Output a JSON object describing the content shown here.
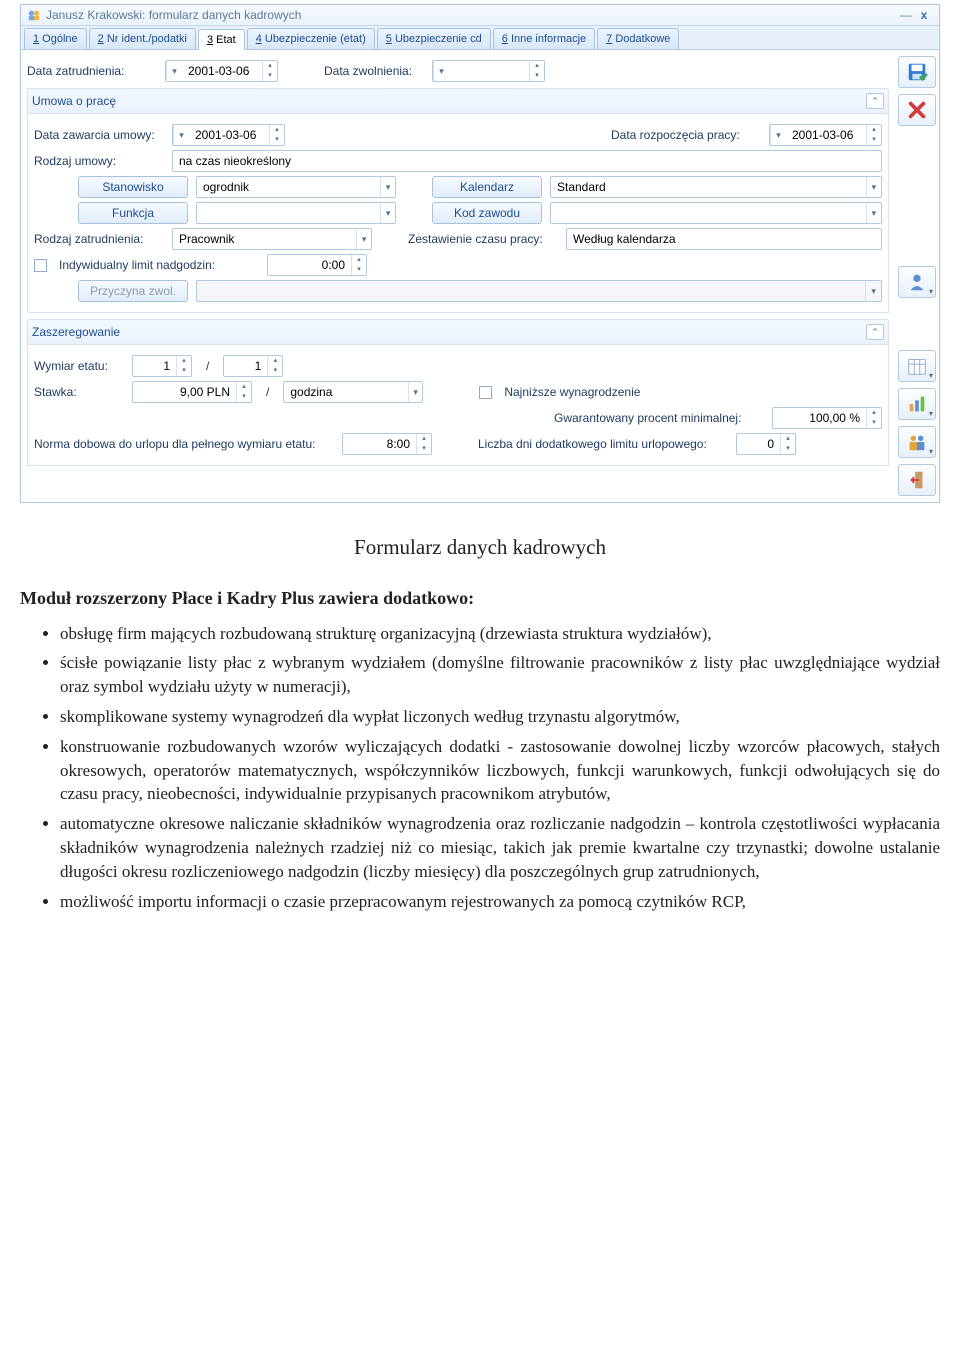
{
  "window": {
    "title": "Janusz Krakowski: formularz danych kadrowych"
  },
  "tabs": [
    {
      "num": "1",
      "label": "Ogólne"
    },
    {
      "num": "2",
      "label": "Nr ident./podatki"
    },
    {
      "num": "3",
      "label": "Etat",
      "active": true
    },
    {
      "num": "4",
      "label": "Ubezpieczenie (etat)"
    },
    {
      "num": "5",
      "label": "Ubezpieczenie cd"
    },
    {
      "num": "6",
      "label": "Inne informacje"
    },
    {
      "num": "7",
      "label": "Dodatkowe"
    }
  ],
  "dates": {
    "data_zatrudnienia_label": "Data zatrudnienia:",
    "data_zatrudnienia": "2001-03-06",
    "data_zwolnienia_label": "Data zwolnienia:",
    "data_zwolnienia": ""
  },
  "umowa": {
    "header": "Umowa o pracę",
    "data_zawarcia_label": "Data zawarcia umowy:",
    "data_zawarcia": "2001-03-06",
    "data_rozpoczecia_label": "Data rozpoczęcia pracy:",
    "data_rozpoczecia": "2001-03-06",
    "rodzaj_umowy_label": "Rodzaj umowy:",
    "rodzaj_umowy": "na czas nieokreślony",
    "stanowisko_btn": "Stanowisko",
    "stanowisko": "ogrodnik",
    "kalendarz_btn": "Kalendarz",
    "kalendarz": "Standard",
    "funkcja_btn": "Funkcja",
    "funkcja": "",
    "kod_zawodu_btn": "Kod zawodu",
    "kod_zawodu": "",
    "rodzaj_zatrudnienia_label": "Rodzaj zatrudnienia:",
    "rodzaj_zatrudnienia": "Pracownik",
    "zestawienie_label": "Zestawienie czasu pracy:",
    "zestawienie": "Według kalendarza",
    "limit_chk_label": "Indywidualny limit nadgodzin:",
    "limit_value": "0:00",
    "przyczyna_btn": "Przyczyna zwol."
  },
  "zaszeregowanie": {
    "header": "Zaszeregowanie",
    "wymiar_label": "Wymiar etatu:",
    "wymiar_a": "1",
    "wymiar_b": "1",
    "stawka_label": "Stawka:",
    "stawka": "9,00 PLN",
    "stawka_unit": "godzina",
    "najnizsze_label": "Najniższe wynagrodzenie",
    "gwarantowany_label": "Gwarantowany procent minimalnej:",
    "gwarantowany": "100,00 %",
    "norma_label": "Norma dobowa do urlopu dla pełnego wymiaru etatu:",
    "norma": "8:00",
    "liczba_dni_label": "Liczba dni dodatkowego limitu urlopowego:",
    "liczba_dni": "0"
  },
  "article": {
    "caption": "Formularz danych kadrowych",
    "heading": "Moduł rozszerzony Płace i Kadry Plus zawiera dodatkowo:",
    "items": [
      "obsługę firm mających rozbudowaną strukturę organizacyjną (drzewiasta struktura wydziałów),",
      "ścisłe powiązanie listy płac z wybranym wydziałem (domyślne filtrowanie pracowników z listy płac uwzględniające wydział oraz symbol wydziału użyty w numeracji),",
      "skomplikowane systemy wynagrodzeń dla wypłat liczonych według trzynastu algorytmów,",
      "konstruowanie rozbudowanych wzorów wyliczających dodatki - zastosowanie dowolnej liczby wzorców płacowych, stałych okresowych, operatorów matematycznych, współczynników liczbowych, funkcji warunkowych, funkcji odwołujących się do czasu pracy, nieobecności, indywidualnie przypisanych pracownikom atrybutów,",
      "automatyczne okresowe naliczanie składników wynagrodzenia oraz rozliczanie nadgodzin – kontrola częstotliwości wypłacania składników wynagrodzenia należnych rzadziej niż co miesiąc, takich jak premie kwartalne czy trzynastki; dowolne ustalanie długości okresu rozliczeniowego nadgodzin (liczby miesięcy) dla poszczególnych grup zatrudnionych,",
      "możliwość importu informacji o czasie przepracowanym rejestrowanych za pomocą czytników RCP,"
    ]
  }
}
